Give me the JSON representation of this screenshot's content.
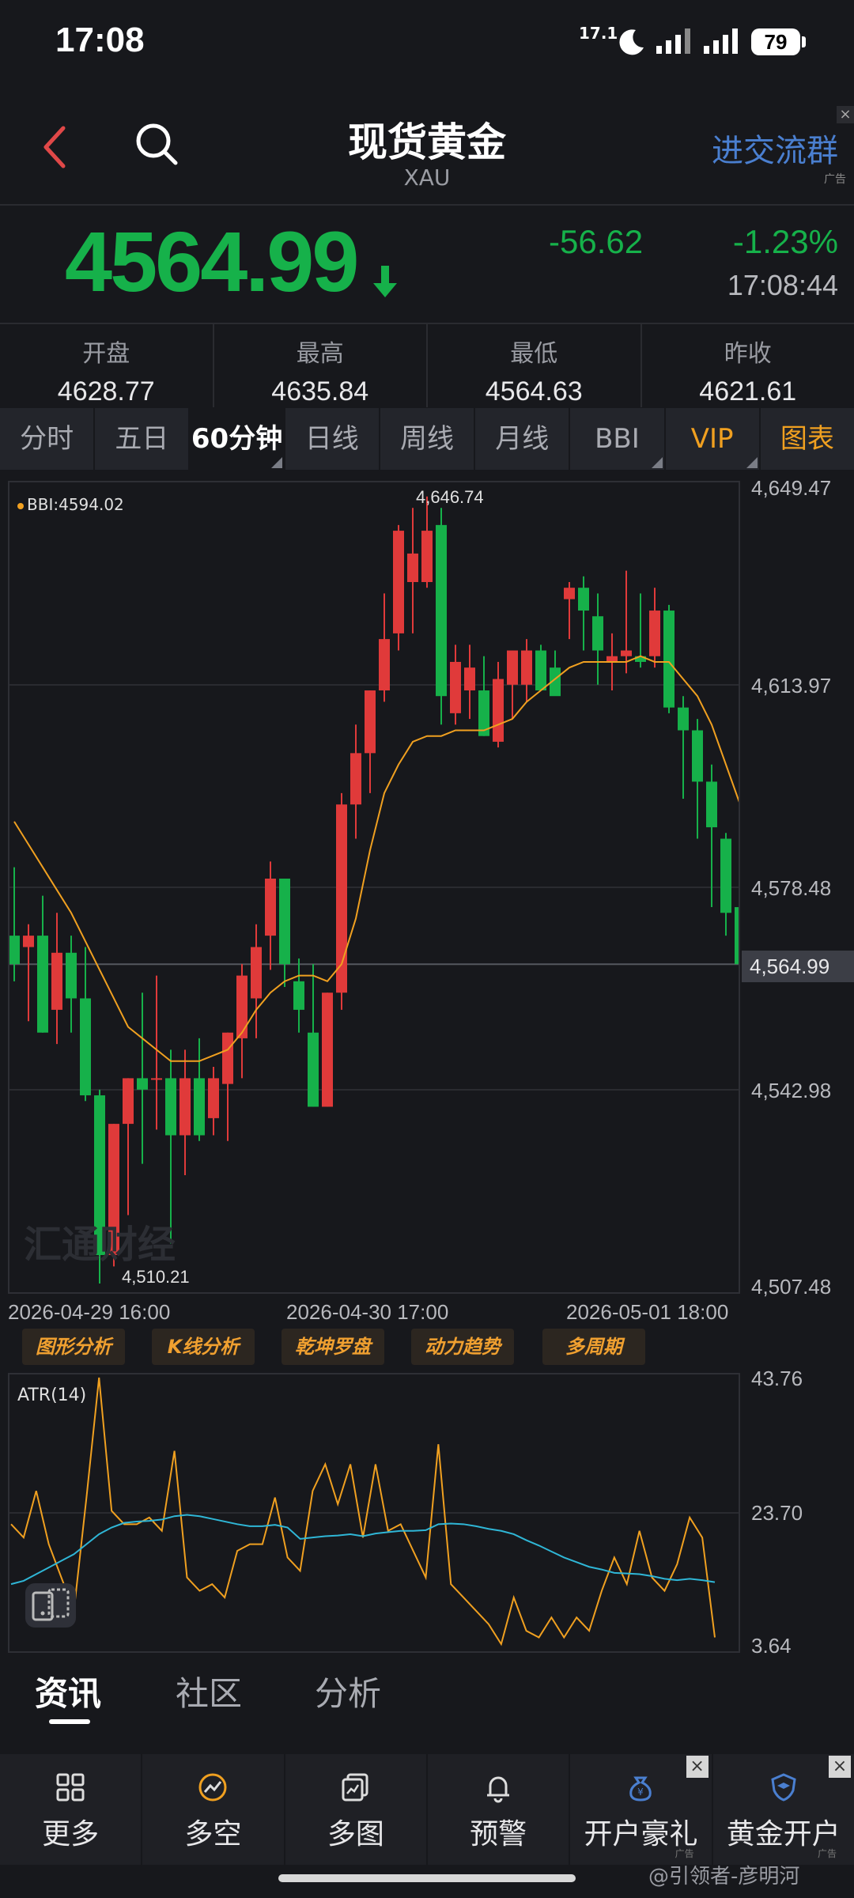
{
  "status_bar": {
    "time": "17:08",
    "network": "17.1",
    "battery": "79"
  },
  "header": {
    "title": "现货黄金",
    "subtitle": "XAU",
    "ad_link": "进交流群",
    "ad_tag": "广告",
    "ad_close": "×"
  },
  "quote": {
    "price": "4564.99",
    "change": "-56.62",
    "change_pct": "-1.23%",
    "time": "17:08:44",
    "color_down": "#16b14a",
    "color_up": "#e03a3a"
  },
  "stats": [
    {
      "label": "开盘",
      "value": "4628.77"
    },
    {
      "label": "最高",
      "value": "4635.84"
    },
    {
      "label": "最低",
      "value": "4564.63"
    },
    {
      "label": "昨收",
      "value": "4621.61"
    }
  ],
  "period_tabs": [
    "分时",
    "五日",
    "60分钟",
    "日线",
    "周线",
    "月线",
    "BBI",
    "VIP",
    "图表"
  ],
  "main_chart": {
    "bbi_label": "BBI:4594.02",
    "y_axis": [
      "4,649.47",
      "4,613.97",
      "4,578.48",
      "4,564.99",
      "4,542.98",
      "4,507.48"
    ],
    "x_axis": [
      "2026-04-29 16:00",
      "2026-04-30 17:00",
      "2026-05-01 18:00"
    ],
    "high_annotation": "4,646.74",
    "low_annotation": "4,510.21",
    "watermark": "汇通财经"
  },
  "tools": [
    "图形分析",
    "K线分析",
    "乾坤罗盘",
    "动力趋势",
    "多周期"
  ],
  "atr_chart": {
    "label": "ATR(14)",
    "y_axis": [
      "43.76",
      "23.70",
      "3.64"
    ]
  },
  "chart_data": [
    {
      "type": "candlestick",
      "title": "",
      "ylim": [
        4507.48,
        4649.47
      ],
      "overlay": "BBI",
      "candles": [
        {
          "o": 4570,
          "h": 4582,
          "l": 4562,
          "c": 4565
        },
        {
          "o": 4568,
          "h": 4572,
          "l": 4555,
          "c": 4570
        },
        {
          "o": 4570,
          "h": 4577,
          "l": 4553,
          "c": 4553
        },
        {
          "o": 4557,
          "h": 4574,
          "l": 4551,
          "c": 4567
        },
        {
          "o": 4567,
          "h": 4570,
          "l": 4553,
          "c": 4559
        },
        {
          "o": 4559,
          "h": 4568,
          "l": 4541,
          "c": 4542
        },
        {
          "o": 4542,
          "h": 4543,
          "l": 4509,
          "c": 4514
        },
        {
          "o": 4514,
          "h": 4537,
          "l": 4512,
          "c": 4537
        },
        {
          "o": 4537,
          "h": 4545,
          "l": 4521,
          "c": 4545
        },
        {
          "o": 4545,
          "h": 4560,
          "l": 4530,
          "c": 4543
        },
        {
          "o": 4545,
          "h": 4563,
          "l": 4536,
          "c": 4545
        },
        {
          "o": 4545,
          "h": 4550,
          "l": 4516,
          "c": 4535
        },
        {
          "o": 4535,
          "h": 4550,
          "l": 4528,
          "c": 4545
        },
        {
          "o": 4545,
          "h": 4552,
          "l": 4534,
          "c": 4535
        },
        {
          "o": 4538,
          "h": 4547,
          "l": 4535,
          "c": 4545
        },
        {
          "o": 4544,
          "h": 4553,
          "l": 4534,
          "c": 4553
        },
        {
          "o": 4552,
          "h": 4565,
          "l": 4545,
          "c": 4563
        },
        {
          "o": 4559,
          "h": 4572,
          "l": 4552,
          "c": 4568
        },
        {
          "o": 4570,
          "h": 4583,
          "l": 4564,
          "c": 4580
        },
        {
          "o": 4580,
          "h": 4579,
          "l": 4561,
          "c": 4565
        },
        {
          "o": 4562,
          "h": 4566,
          "l": 4553,
          "c": 4557
        },
        {
          "o": 4553,
          "h": 4565,
          "l": 4540,
          "c": 4540
        },
        {
          "o": 4540,
          "h": 4560,
          "l": 4540,
          "c": 4560
        },
        {
          "o": 4560,
          "h": 4595,
          "l": 4557,
          "c": 4593
        },
        {
          "o": 4593,
          "h": 4607,
          "l": 4587,
          "c": 4602
        },
        {
          "o": 4602,
          "h": 4613,
          "l": 4595,
          "c": 4613
        },
        {
          "o": 4613,
          "h": 4630,
          "l": 4611,
          "c": 4622
        },
        {
          "o": 4623,
          "h": 4642,
          "l": 4620,
          "c": 4641
        },
        {
          "o": 4632,
          "h": 4645,
          "l": 4623,
          "c": 4637
        },
        {
          "o": 4632,
          "h": 4647,
          "l": 4631,
          "c": 4641
        },
        {
          "o": 4642,
          "h": 4645,
          "l": 4607,
          "c": 4612
        },
        {
          "o": 4609,
          "h": 4621,
          "l": 4607,
          "c": 4618
        },
        {
          "o": 4613,
          "h": 4621,
          "l": 4608,
          "c": 4617
        },
        {
          "o": 4613,
          "h": 4619,
          "l": 4605,
          "c": 4605
        },
        {
          "o": 4604,
          "h": 4618,
          "l": 4603,
          "c": 4615
        },
        {
          "o": 4614,
          "h": 4620,
          "l": 4608,
          "c": 4620
        },
        {
          "o": 4614,
          "h": 4622,
          "l": 4611,
          "c": 4620
        },
        {
          "o": 4620,
          "h": 4621,
          "l": 4613,
          "c": 4613
        },
        {
          "o": 4617,
          "h": 4620,
          "l": 4614,
          "c": 4612
        },
        {
          "o": 4629,
          "h": 4632,
          "l": 4622,
          "c": 4631
        },
        {
          "o": 4631,
          "h": 4633,
          "l": 4620,
          "c": 4627
        },
        {
          "o": 4626,
          "h": 4630,
          "l": 4614,
          "c": 4620
        },
        {
          "o": 4618,
          "h": 4623,
          "l": 4613,
          "c": 4619
        },
        {
          "o": 4619,
          "h": 4634,
          "l": 4616,
          "c": 4620
        },
        {
          "o": 4619,
          "h": 4630,
          "l": 4617,
          "c": 4618
        },
        {
          "o": 4619,
          "h": 4631,
          "l": 4617,
          "c": 4627
        },
        {
          "o": 4627,
          "h": 4628,
          "l": 4609,
          "c": 4610
        },
        {
          "o": 4610,
          "h": 4612,
          "l": 4594,
          "c": 4606
        },
        {
          "o": 4606,
          "h": 4608,
          "l": 4587,
          "c": 4597
        },
        {
          "o": 4597,
          "h": 4600,
          "l": 4575,
          "c": 4589
        },
        {
          "o": 4587,
          "h": 4588,
          "l": 4570,
          "c": 4574
        },
        {
          "o": 4575,
          "h": 4576,
          "l": 4565,
          "c": 4565
        },
        {
          "o": 4568,
          "h": 4569,
          "l": 4564,
          "c": 4565
        }
      ],
      "bbi": [
        4590,
        4586,
        4582,
        4578,
        4574,
        4569,
        4564,
        4559,
        4554,
        4552,
        4550,
        4548,
        4548,
        4548,
        4549,
        4550,
        4553,
        4557,
        4560,
        4562,
        4563,
        4563,
        4562,
        4565,
        4573,
        4585,
        4595,
        4600,
        4604,
        4605,
        4605,
        4606,
        4606,
        4606,
        4607,
        4608,
        4611,
        4613,
        4615,
        4617,
        4618,
        4618,
        4618,
        4618,
        4619,
        4618,
        4618,
        4615,
        4612,
        4607,
        4600,
        4593,
        4587
      ]
    },
    {
      "type": "line",
      "title": "ATR(14)",
      "ylim": [
        3.64,
        43.76
      ],
      "series": [
        {
          "values": [
            22,
            20,
            27,
            19,
            14,
            9,
            26,
            44,
            24,
            22,
            22,
            23,
            21,
            33,
            14,
            12,
            13,
            11,
            18,
            19,
            19,
            26,
            17,
            15,
            27,
            31,
            25,
            31,
            20,
            31,
            21,
            22,
            18,
            14,
            34,
            13,
            11,
            9,
            7,
            4,
            11,
            6,
            5,
            8,
            5,
            8,
            6,
            12,
            17,
            13,
            21,
            14,
            12,
            16,
            23,
            20,
            5
          ]
        },
        {
          "values": [
            13,
            13.5,
            14.5,
            15.5,
            16.5,
            17.5,
            19,
            20.5,
            21.5,
            22.2,
            22.4,
            22.5,
            22.7,
            23.2,
            23.4,
            23.2,
            22.8,
            22.4,
            22,
            21.7,
            21.7,
            21.9,
            21.5,
            19.8,
            20,
            20.2,
            20.3,
            20.5,
            20.2,
            20.6,
            20.8,
            21,
            21,
            21.1,
            22,
            22.1,
            22,
            21.7,
            21.3,
            21,
            20.5,
            19.6,
            18.8,
            17.9,
            17,
            16.3,
            15.6,
            15.2,
            14.7,
            14.6,
            14.5,
            14.2,
            13.8,
            13.6,
            13.8,
            13.6,
            13.3
          ]
        }
      ]
    }
  ],
  "news_tabs": [
    "资讯",
    "社区",
    "分析"
  ],
  "bottom_nav": [
    {
      "label": "更多",
      "icon": "grid-icon"
    },
    {
      "label": "多空",
      "icon": "trend-circle-icon"
    },
    {
      "label": "多图",
      "icon": "multi-chart-icon"
    },
    {
      "label": "预警",
      "icon": "bell-icon"
    },
    {
      "label": "开户豪礼",
      "icon": "money-bag-icon",
      "ad": "广告"
    },
    {
      "label": "黄金开户",
      "icon": "shield-icon",
      "ad": "广告"
    }
  ],
  "watermark_footer": "@引领者-彦明河"
}
